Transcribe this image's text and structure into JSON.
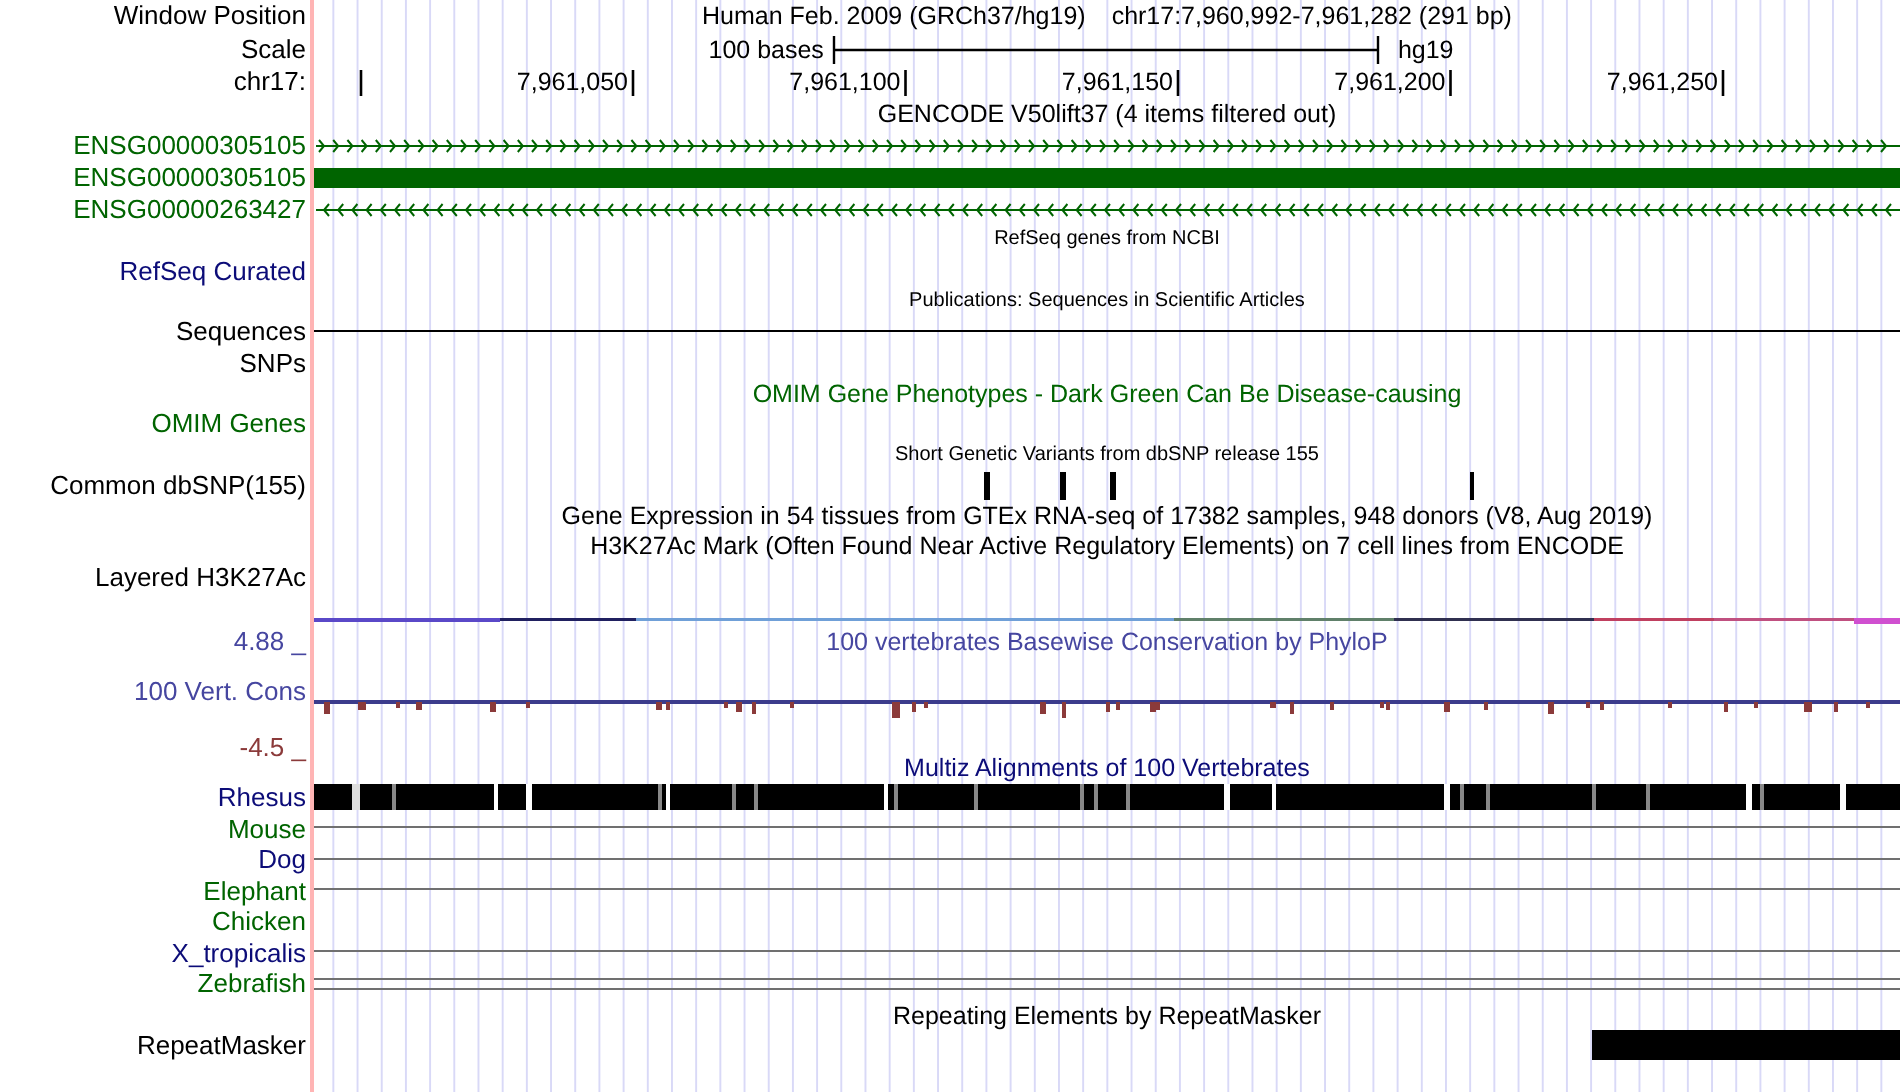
{
  "header": {
    "label": "Window Position",
    "assembly": "Human Feb. 2009 (GRCh37/hg19)",
    "position": "chr17:7,960,992-7,961,282 (291 bp)"
  },
  "scale": {
    "label": "Scale",
    "length": "100 bases",
    "assembly": "hg19"
  },
  "ruler": {
    "label": "chr17:",
    "ticks": [
      "7,961,050",
      "7,961,100",
      "7,961,150",
      "7,961,200",
      "7,961,250"
    ]
  },
  "tracks": [
    {
      "kind": "full",
      "title": "GENCODE V50lift37 (4 items filtered out)",
      "color": "#000000",
      "rows": [
        {
          "label": "ENSG00000305105",
          "color": "#006400",
          "kind": "plus-strand"
        },
        {
          "label": "ENSG00000305105",
          "color": "#006400",
          "kind": "exon"
        },
        {
          "label": "ENSG00000263427",
          "color": "#006400",
          "kind": "minus-strand"
        }
      ]
    },
    {
      "kind": "dense",
      "title": "RefSeq genes from NCBI",
      "color": "#000000",
      "rows": [
        {
          "label": "RefSeq Curated",
          "color": "#0c0c78",
          "kind": "empty"
        }
      ]
    },
    {
      "kind": "dense",
      "title": "Publications: Sequences in Scientific Articles",
      "color": "#000000",
      "rows": [
        {
          "label": "Sequences",
          "color": "#000000",
          "kind": "line"
        },
        {
          "label": "SNPs",
          "color": "#000000",
          "kind": "empty"
        }
      ]
    },
    {
      "kind": "full",
      "title": "OMIM Gene Phenotypes - Dark Green Can Be Disease-causing",
      "color": "#006400",
      "rows": [
        {
          "label": "OMIM Genes",
          "color": "#006400",
          "kind": "empty"
        }
      ]
    },
    {
      "kind": "dense",
      "title": "Short Genetic Variants from dbSNP release 155",
      "color": "#000000",
      "rows": [
        {
          "label": "Common dbSNP(155)",
          "color": "#000000",
          "kind": "snps"
        }
      ]
    },
    {
      "kind": "full",
      "title": "Gene Expression in 54 tissues from GTEx RNA-seq of 17382 samples, 948 donors (V8, Aug 2019)",
      "color": "#000000"
    },
    {
      "kind": "full",
      "title": "H3K27Ac Mark (Often Found Near Active Regulatory Elements) on 7 cell lines from ENCODE",
      "color": "#000000",
      "rows": [
        {
          "label": "Layered H3K27Ac",
          "color": "#000000",
          "kind": "empty"
        },
        {
          "kind": "signal"
        }
      ]
    },
    {
      "kind": "wiggle",
      "title": "100 vertebrates Basewise Conservation by PhyloP",
      "color": "#4646a0",
      "max_label": "4.88 _",
      "min_label": {
        "text": "-4.5 _",
        "color": "#8b3a3a"
      },
      "rows": [
        {
          "label": "100 Vert. Cons",
          "color": "#4646a0",
          "kind": "conservation"
        }
      ]
    },
    {
      "kind": "full",
      "title": "Multiz Alignments of 100 Vertebrates",
      "color": "#0c0c78",
      "rows": [
        {
          "label": "Rhesus",
          "color": "#0c0c78",
          "kind": "alignment"
        },
        {
          "label": "Mouse",
          "color": "#006400",
          "kind": "rule"
        },
        {
          "label": "Dog",
          "color": "#0c0c78",
          "kind": "rule"
        },
        {
          "label": "Elephant",
          "color": "#006400",
          "kind": "rule"
        },
        {
          "label": "Chicken",
          "color": "#006400",
          "kind": "empty"
        },
        {
          "label": "X_tropicalis",
          "color": "#0c0c78",
          "kind": "rule"
        },
        {
          "label": "Zebrafish",
          "color": "#006400",
          "kind": "double-rule"
        }
      ]
    },
    {
      "kind": "full",
      "title": "Repeating Elements by RepeatMasker",
      "color": "#000000",
      "rows": [
        {
          "label": "RepeatMasker",
          "color": "#000000",
          "kind": "repeat"
        }
      ]
    }
  ]
}
